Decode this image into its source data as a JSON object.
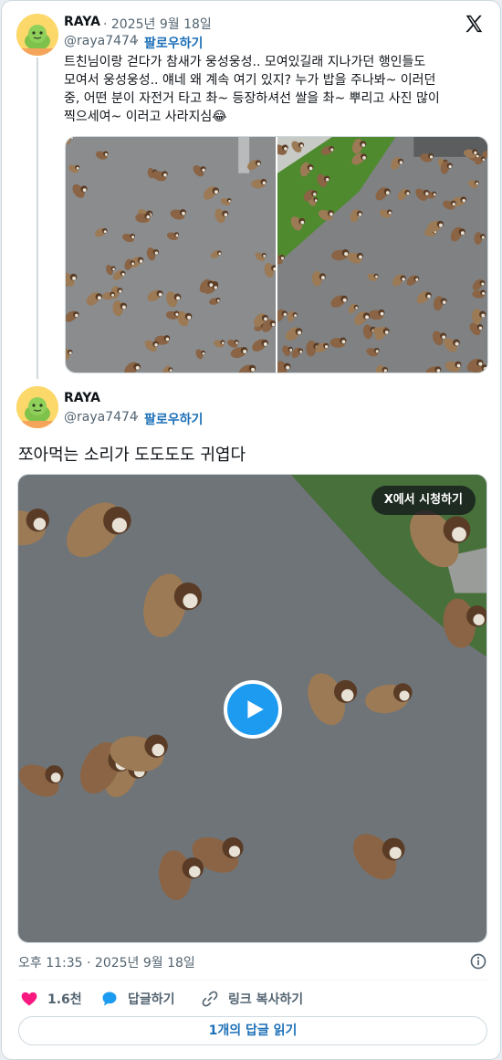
{
  "tweet1": {
    "name": "RAYA",
    "date": "· 2025년 9월 18일",
    "handle": "@raya7474",
    "sep": "·",
    "follow": "팔로우하기",
    "lines": [
      "트친님이랑 걷다가 참새가 웅성웅성.. 모여있길래 지나가던 행인들도",
      "모여서 웅성웅성.. 얘네 왜 계속 여기 있지? 누가 밥을 주나봐~ 이러던",
      "중, 어떤 분이 자전거 타고 촤~ 등장하셔선 쌀을 촤~ 뿌리고 사진 많이",
      "찍으세여~ 이러고 사라지심😂"
    ],
    "images": [
      "sparrows-on-pavement-photo",
      "sparrows-by-grass-photo"
    ]
  },
  "tweet2": {
    "name": "RAYA",
    "handle": "@raya7474",
    "sep": "·",
    "follow": "팔로우하기",
    "text": "쪼아먹는 소리가 도도도도 귀엽다",
    "video": {
      "watch_label": "X에서 시청하기",
      "play_icon": "play-icon"
    },
    "timestamp": "오후 11:35 · 2025년 9월 18일"
  },
  "actions": {
    "likes": "1.6천",
    "reply": "답글하기",
    "copy_link": "링크 복사하기",
    "read_replies": "1개의 답글 읽기"
  },
  "icons": {
    "brand": "x-logo-icon",
    "like": "heart-icon",
    "reply": "speech-bubble-icon",
    "copy": "link-icon",
    "info": "info-icon"
  },
  "colors": {
    "link": "#1d70b8",
    "like": "#f91880",
    "accent": "#1d9bf0",
    "muted": "#536471"
  }
}
